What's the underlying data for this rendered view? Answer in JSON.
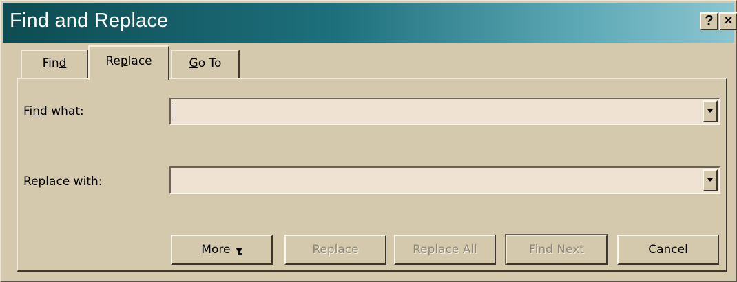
{
  "window": {
    "title": "Find and Replace",
    "help_button": "?",
    "close_button": "×"
  },
  "tabs": [
    {
      "label_before": "Fin",
      "label_accel": "d",
      "label_after": ""
    },
    {
      "label_before": "Re",
      "label_accel": "p",
      "label_after": "lace"
    },
    {
      "label_before": "",
      "label_accel": "G",
      "label_after": "o To"
    }
  ],
  "selected_tab": "Replace",
  "fields": {
    "find_what": {
      "label_before": "Fi",
      "label_accel": "n",
      "label_after": "d what:",
      "value": ""
    },
    "replace_with": {
      "label_before": "Replace w",
      "label_accel": "i",
      "label_after": "th:",
      "value": ""
    }
  },
  "buttons": {
    "more": {
      "label_before": "",
      "label_accel": "M",
      "label_after": "ore",
      "icon": "double-chevron-down-icon"
    },
    "replace": {
      "label": "Replace",
      "enabled": false
    },
    "replace_all": {
      "label": "Replace All",
      "enabled": false
    },
    "find_next": {
      "label": "Find Next",
      "enabled": false
    },
    "cancel": {
      "label": "Cancel",
      "enabled": true
    }
  }
}
